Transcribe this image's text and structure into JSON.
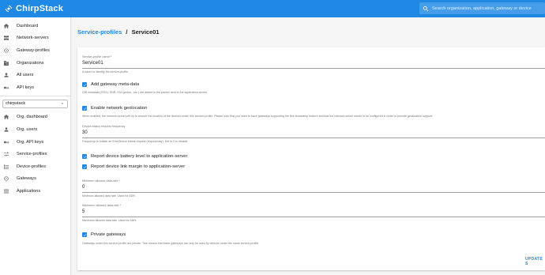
{
  "app": {
    "brand": "ChirpStack",
    "search_placeholder": "Search organization, application, gateway or device"
  },
  "colors": {
    "primary": "#1e88e5",
    "sidebar_bg": "#ffffff",
    "page_bg": "#f5f5f5"
  },
  "sidebar": {
    "admin_items": [
      {
        "icon": "home-icon",
        "label": "Dashboard"
      },
      {
        "icon": "server-icon",
        "label": "Network-servers"
      },
      {
        "icon": "wifi-icon",
        "label": "Gateway-profiles"
      },
      {
        "icon": "domain-icon",
        "label": "Organizations"
      },
      {
        "icon": "account-icon",
        "label": "All users"
      },
      {
        "icon": "key-icon",
        "label": "API keys"
      }
    ],
    "org_select": "chirpstack",
    "org_items": [
      {
        "icon": "home-icon",
        "label": "Org. dashboard"
      },
      {
        "icon": "account-icon",
        "label": "Org. users"
      },
      {
        "icon": "key-icon",
        "label": "Org. API keys"
      },
      {
        "icon": "tune-icon",
        "label": "Service-profiles"
      },
      {
        "icon": "list-icon",
        "label": "Device-profiles"
      },
      {
        "icon": "wifi-icon",
        "label": "Gateways"
      },
      {
        "icon": "apps-icon",
        "label": "Applications"
      }
    ]
  },
  "breadcrumb": {
    "parent": "Service-profiles",
    "separator": "/",
    "current": "Service01"
  },
  "form": {
    "name": {
      "label": "Service-profile name *",
      "value": "Service01",
      "help": "A name to identify the service-profile."
    },
    "add_gw_meta": {
      "label": "Add gateway meta-data",
      "checked": true,
      "help": "GW metadata (RSSI, SNR, GW geoloc., etc.) are added to the packet sent to the application-server."
    },
    "network_geo": {
      "label": "Enable network geolocation",
      "checked": true,
      "help": "When enabled, the network-server will try to resolve the location of the devices under this service-profile. Please note that you need to have gateways supporting the fine-timestamp feature and that the network-server needs to be configured in order to provide geolocation support."
    },
    "status_freq": {
      "label": "Device-status request frequency",
      "value": "30",
      "help": "Frequency to initiate an End-Device status request (request/day). Set to 0 to disable."
    },
    "report_battery": {
      "label": "Report device battery level to application-server",
      "checked": true
    },
    "report_margin": {
      "label": "Report device link margin to application-server",
      "checked": true
    },
    "min_dr": {
      "label": "Minimum allowed data-rate *",
      "value": "0",
      "help": "Minimum allowed data rate. Used for ADR."
    },
    "max_dr": {
      "label": "Maximum allowed data-rate *",
      "value": "5",
      "help": "Maximum allowed data rate. Used for ADR."
    },
    "private_gw": {
      "label": "Private gateways",
      "checked": true,
      "help": "Gateways under this service-profile are private. This means that these gateways can only be used by devices under the same service-profile."
    },
    "submit_label": "UPDATE S"
  }
}
